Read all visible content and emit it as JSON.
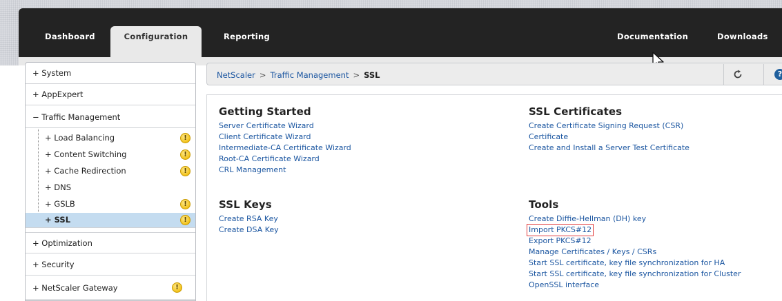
{
  "nav": {
    "tabs": [
      {
        "label": "Dashboard"
      },
      {
        "label": "Configuration"
      },
      {
        "label": "Reporting"
      }
    ],
    "right": [
      {
        "label": "Documentation"
      },
      {
        "label": "Downloads"
      }
    ]
  },
  "sidebar": {
    "top": [
      {
        "label": "+ System"
      },
      {
        "label": "+ AppExpert"
      },
      {
        "label": "− Traffic Management"
      }
    ],
    "sub": [
      {
        "label": "+ Load Balancing",
        "warning": "!"
      },
      {
        "label": "+ Content Switching",
        "warning": "!"
      },
      {
        "label": "+ Cache Redirection",
        "warning": "!"
      },
      {
        "label": "+ DNS"
      },
      {
        "label": "+ GSLB",
        "warning": "!"
      },
      {
        "label": "+ SSL",
        "warning": "!"
      }
    ],
    "bottom": [
      {
        "label": "+ Optimization"
      },
      {
        "label": "+ Security"
      },
      {
        "label": "+ NetScaler Gateway",
        "warning": "!"
      }
    ]
  },
  "breadcrumb": {
    "items": [
      "NetScaler",
      "Traffic Management"
    ],
    "separator": ">",
    "current": "SSL",
    "help": "?"
  },
  "sections": {
    "getting_started": {
      "title": "Getting Started",
      "links": [
        "Server Certificate Wizard",
        "Client Certificate Wizard",
        "Intermediate-CA Certificate Wizard",
        "Root-CA Certificate Wizard",
        "CRL Management"
      ]
    },
    "ssl_certificates": {
      "title": "SSL Certificates",
      "links": [
        "Create Certificate Signing Request (CSR)",
        "Certificate",
        "Create and Install a Server Test Certificate"
      ]
    },
    "ssl_keys": {
      "title": "SSL Keys",
      "links": [
        "Create RSA Key",
        "Create DSA Key"
      ]
    },
    "tools": {
      "title": "Tools",
      "links": [
        "Create Diffie-Hellman (DH) key",
        "Import PKCS#12",
        "Export PKCS#12",
        "Manage Certificates / Keys / CSRs",
        "Start SSL certificate, key file synchronization for HA",
        "Start SSL certificate, key file synchronization for Cluster",
        "OpenSSL interface"
      ]
    }
  },
  "colors": {
    "nav_background": "#232323",
    "link": "#1a55a0",
    "selected_row": "#c4dcf0",
    "highlight_outline": "#e23b3b",
    "warning": "#f2c21b"
  }
}
